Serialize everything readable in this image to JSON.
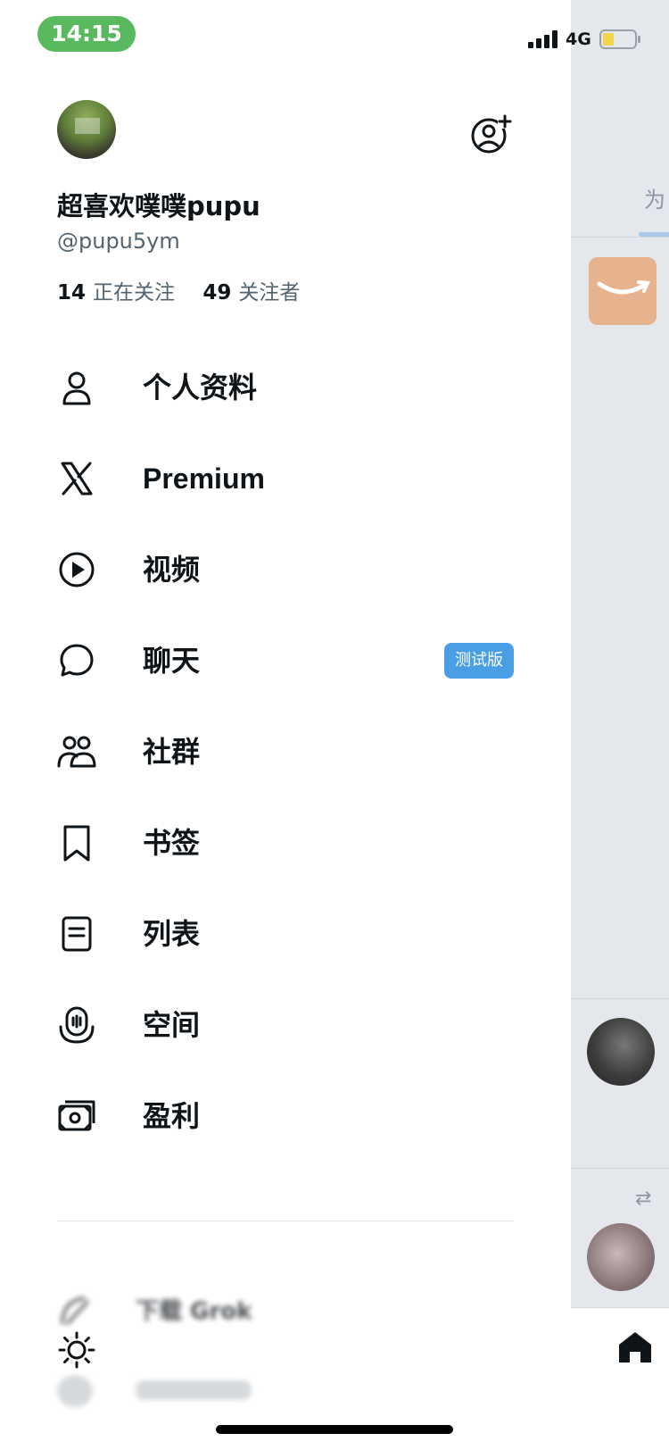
{
  "status_bar": {
    "time": "14:15",
    "network": "4G",
    "battery_color": "#f3d54a"
  },
  "profile": {
    "display_name": "超喜欢噗噗pupu",
    "handle": "@pupu5ym",
    "following_count": "14",
    "following_label": "正在关注",
    "followers_count": "49",
    "followers_label": "关注者"
  },
  "menu": {
    "items": [
      {
        "label": "个人资料",
        "icon": "person-icon"
      },
      {
        "label": "Premium",
        "icon": "x-logo-icon"
      },
      {
        "label": "视频",
        "icon": "play-circle-icon"
      },
      {
        "label": "聊天",
        "icon": "chat-bubble-icon",
        "badge": "测试版"
      },
      {
        "label": "社群",
        "icon": "communities-icon"
      },
      {
        "label": "书签",
        "icon": "bookmark-icon"
      },
      {
        "label": "列表",
        "icon": "list-icon"
      },
      {
        "label": "空间",
        "icon": "spaces-icon"
      },
      {
        "label": "盈利",
        "icon": "money-icon"
      }
    ]
  },
  "bottom": {
    "grok_label": "下载 Grok",
    "theme_icon": "sun-icon"
  },
  "feed": {
    "tab_text": "为"
  },
  "colors": {
    "accent": "#1d9bf0",
    "badge": "#4a9ee3",
    "time_pill": "#59b95e",
    "dim_background": "#e4e7eb"
  }
}
